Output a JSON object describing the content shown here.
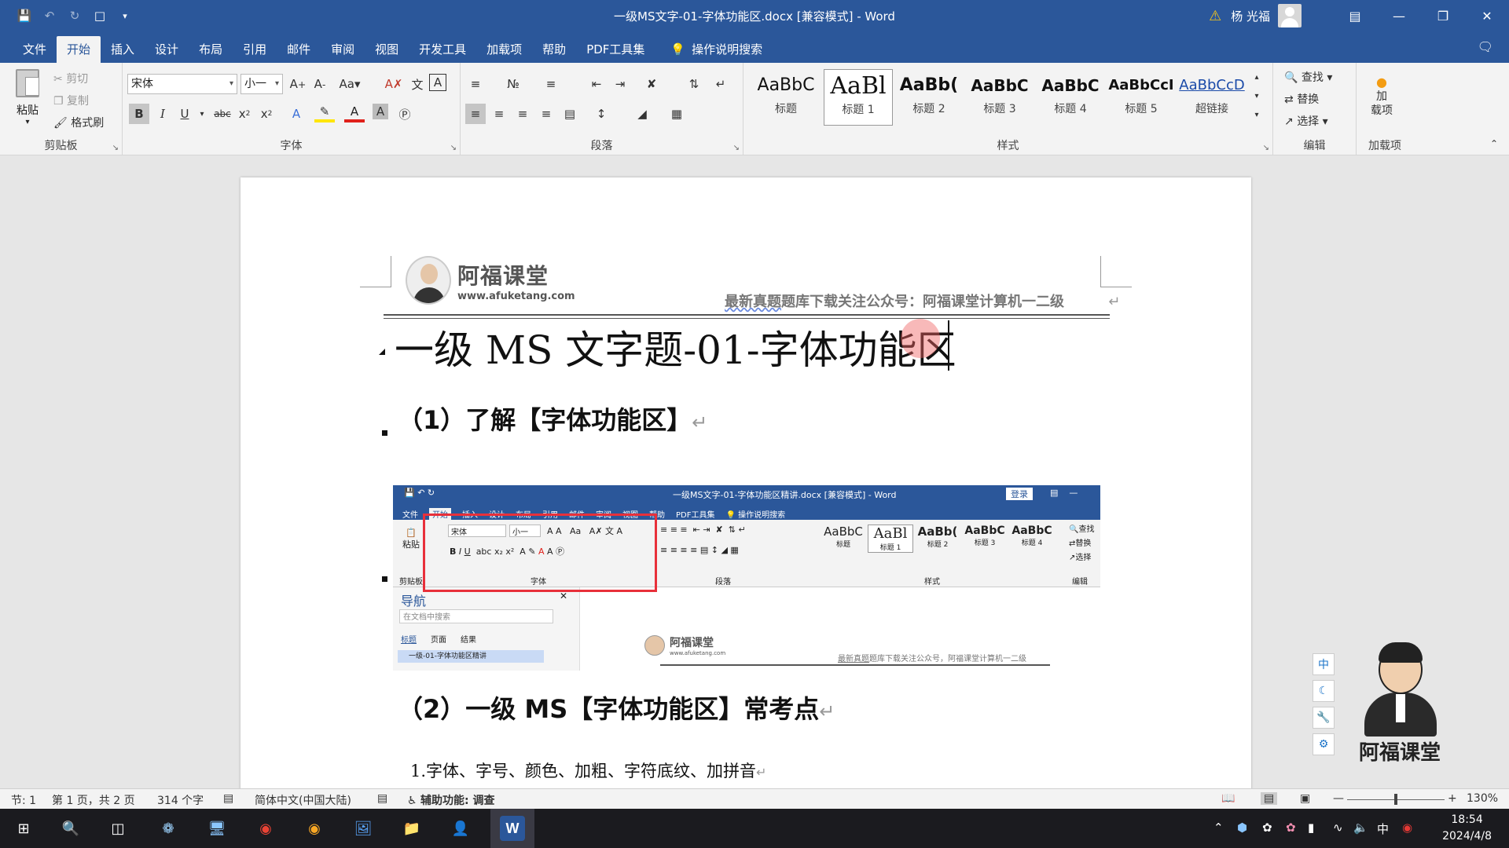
{
  "window": {
    "title": "一级MS文字-01-字体功能区.docx [兼容模式] - Word",
    "user": "杨 光福"
  },
  "menu": {
    "tabs": [
      "文件",
      "开始",
      "插入",
      "设计",
      "布局",
      "引用",
      "邮件",
      "审阅",
      "视图",
      "开发工具",
      "加载项",
      "帮助",
      "PDF工具集"
    ],
    "active": "开始",
    "tell_me": "操作说明搜索"
  },
  "ribbon": {
    "clipboard": {
      "paste": "粘贴",
      "cut": "剪切",
      "copy": "复制",
      "format_painter": "格式刷",
      "label": "剪贴板"
    },
    "font": {
      "name": "宋体",
      "size": "小一",
      "label": "字体"
    },
    "paragraph": {
      "label": "段落"
    },
    "styles": {
      "label": "样式",
      "items": [
        {
          "sample": "AaBbC",
          "name": "标题"
        },
        {
          "sample": "AaBl",
          "name": "标题 1"
        },
        {
          "sample": "AaBb(",
          "name": "标题 2"
        },
        {
          "sample": "AaBbC",
          "name": "标题 3"
        },
        {
          "sample": "AaBbC",
          "name": "标题 4"
        },
        {
          "sample": "AaBbCcI",
          "name": "标题 5"
        },
        {
          "sample": "AaBbCcD",
          "name": "超链接"
        }
      ]
    },
    "editing": {
      "find": "查找",
      "replace": "替换",
      "select": "选择",
      "label": "编辑"
    },
    "addins": {
      "btn": "加\n载项",
      "label": "加载项"
    }
  },
  "document": {
    "logo_cn": "阿福课堂",
    "logo_url": "www.afuketang.com",
    "header_u": "最新真题",
    "header_rest": "题库下载关注公众号：阿福课堂计算机一二级",
    "title": "一级 MS 文字题-01-字体功能区",
    "h2_1": "（1）了解【字体功能区】",
    "h2_2": "（2）一级 MS【字体功能区】常考点",
    "para_1": "1.字体、字号、颜色、加粗、字符底纹、加拼音"
  },
  "embedded": {
    "title": "一级MS文字-01-字体功能区精讲.docx [兼容模式] - Word",
    "login": "登录",
    "tabs": [
      "文件",
      "开始",
      "插入",
      "设计",
      "布局",
      "引用",
      "邮件",
      "审阅",
      "视图",
      "帮助",
      "PDF工具集"
    ],
    "tell_me": "操作说明搜索",
    "font_name": "宋体",
    "font_size": "小一",
    "paste": "粘贴",
    "clipboard_short": "剪贴板",
    "font_label": "字体",
    "para_label": "段落",
    "styles_label": "样式",
    "edit_label": "编辑",
    "find": "查找",
    "replace": "替换",
    "select": "选择",
    "styles": [
      {
        "sample": "AaBbC",
        "name": "标题"
      },
      {
        "sample": "AaBl",
        "name": "标题 1"
      },
      {
        "sample": "AaBb(",
        "name": "标题 2"
      },
      {
        "sample": "AaBbC",
        "name": "标题 3"
      },
      {
        "sample": "AaBbC",
        "name": "标题 4"
      }
    ],
    "nav_title": "导航",
    "nav_search": "在文档中搜索",
    "nav_tabs": [
      "标题",
      "页面",
      "结果"
    ],
    "nav_item": "一级-01-字体功能区精讲",
    "logo_cn": "阿福课堂",
    "logo_url": "www.afuketang.com",
    "header_u": "最新真题",
    "header_rest": "题库下载关注公众号，阿福课堂计算机一二级"
  },
  "side_tools": [
    "中"
  ],
  "mascot_text": "阿福课堂",
  "status": {
    "section": "节: 1",
    "page": "第 1 页，共 2 页",
    "words": "314 个字",
    "language": "简体中文(中国大陆)",
    "accessibility": "辅助功能: 调查",
    "zoom": "130%",
    "zoom_fraction": 0.5
  },
  "taskbar": {
    "time": "18:54",
    "date": "2024/4/8",
    "ime": "中"
  },
  "colors": {
    "word_blue": "#2b579a",
    "highlight_red": "#e8303a"
  }
}
